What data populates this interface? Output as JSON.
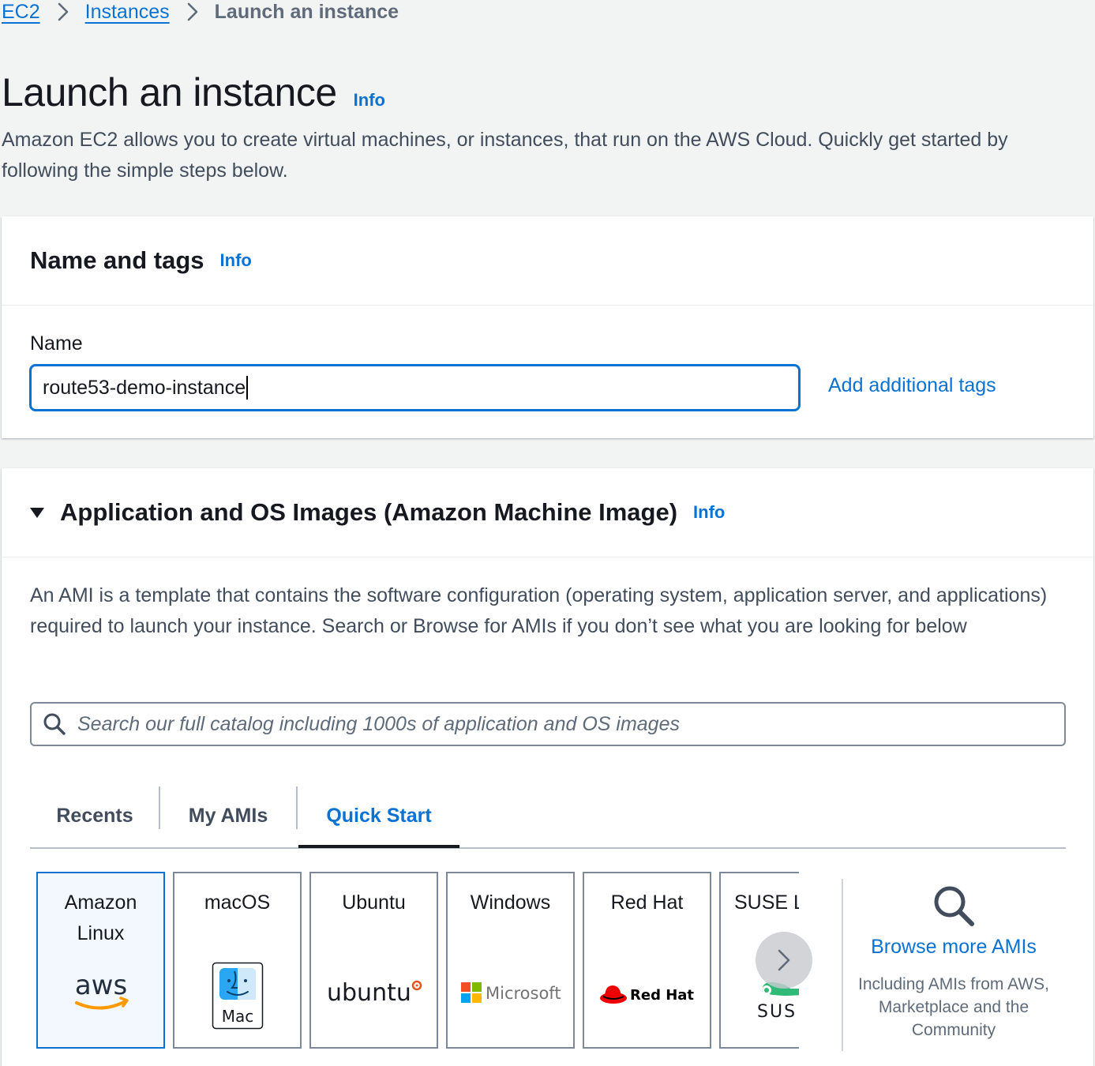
{
  "breadcrumb": {
    "items": [
      "EC2",
      "Instances"
    ],
    "current": "Launch an instance"
  },
  "header": {
    "title": "Launch an instance",
    "info": "Info",
    "description": "Amazon EC2 allows you to create virtual machines, or instances, that run on the AWS Cloud. Quickly get started by following the simple steps below."
  },
  "name_and_tags": {
    "title": "Name and tags",
    "info": "Info",
    "name_label": "Name",
    "name_value": "route53-demo-instance",
    "add_tags_label": "Add additional tags"
  },
  "ami": {
    "title": "Application and OS Images (Amazon Machine Image)",
    "info": "Info",
    "description": "An AMI is a template that contains the software configuration (operating system, application server, and applications) required to launch your instance. Search or Browse for AMIs if you don’t see what you are looking for below",
    "search_placeholder": "Search our full catalog including 1000s of application and OS images",
    "tabs": [
      "Recents",
      "My AMIs",
      "Quick Start"
    ],
    "active_tab": "Quick Start",
    "tiles": [
      {
        "label": "Amazon Linux",
        "logo_text": "aws",
        "icon": "aws-logo-icon",
        "selected": true
      },
      {
        "label": "macOS",
        "logo_text": "Mac",
        "icon": "mac-finder-icon",
        "selected": false
      },
      {
        "label": "Ubuntu",
        "logo_text": "ubuntu",
        "icon": "ubuntu-logo-icon",
        "selected": false
      },
      {
        "label": "Windows",
        "logo_text": "Microsoft",
        "icon": "microsoft-logo-icon",
        "selected": false
      },
      {
        "label": "Red Hat",
        "logo_text": "Red Hat",
        "icon": "redhat-logo-icon",
        "selected": false
      },
      {
        "label": "SUSE Li",
        "logo_text": "SUS",
        "icon": "suse-logo-icon",
        "selected": false
      }
    ],
    "browse": {
      "title": "Browse more AMIs",
      "description": "Including AMIs from AWS, Marketplace and the Community"
    }
  },
  "colors": {
    "link": "#0972d3",
    "page_bg": "#f2f3f3",
    "selected_tile_bg": "#f2f8fd",
    "text": "#16191f",
    "secondary_text": "#5f6b7a"
  }
}
